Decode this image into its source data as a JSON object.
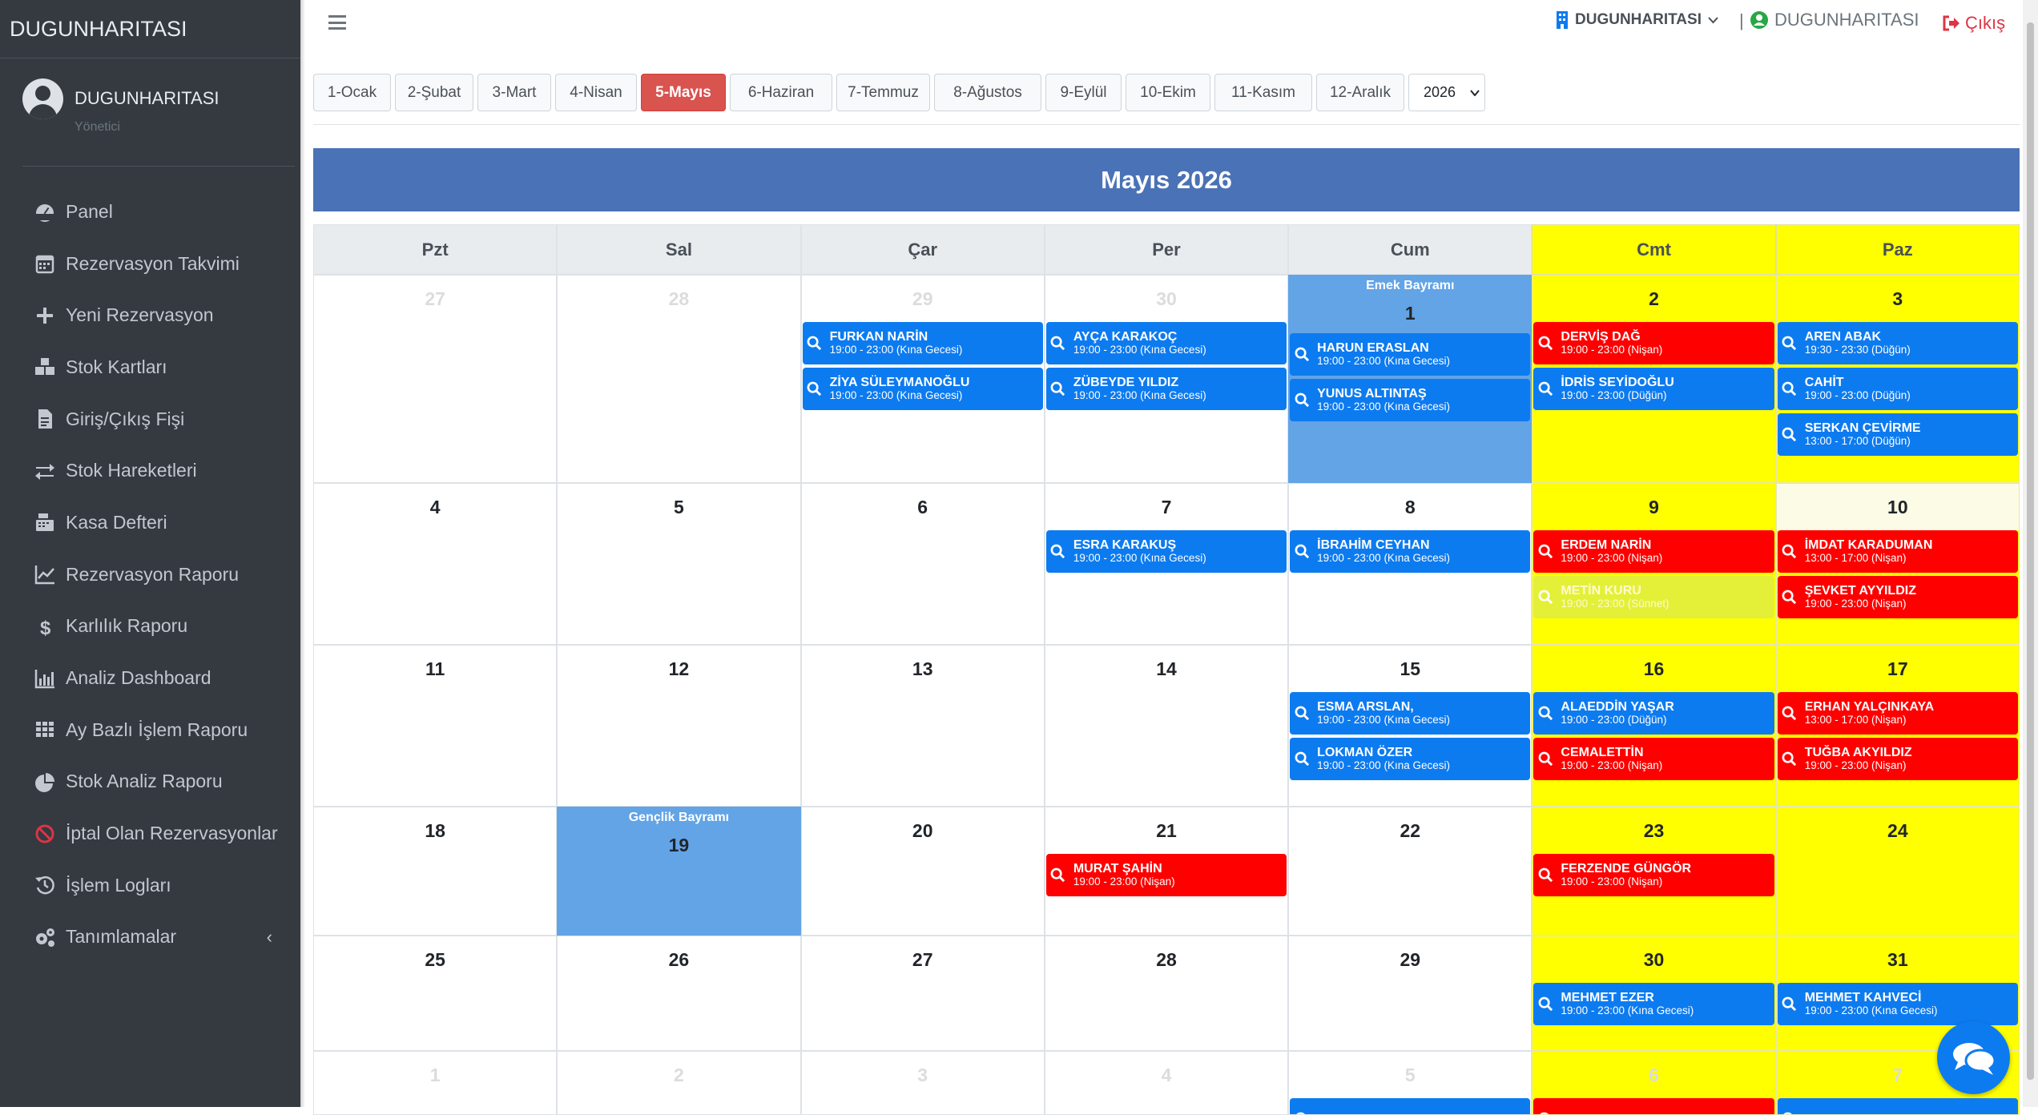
{
  "app": {
    "brand": "DUGUNHARITASI",
    "user_name": "DUGUNHARITASI",
    "user_role": "Yönetici"
  },
  "sidebar": {
    "items": [
      {
        "label": "Panel",
        "icon": "dashboard-icon"
      },
      {
        "label": "Rezervasyon Takvimi",
        "icon": "calendar-icon"
      },
      {
        "label": "Yeni Rezervasyon",
        "icon": "plus-icon"
      },
      {
        "label": "Stok Kartları",
        "icon": "boxes-icon"
      },
      {
        "label": "Giriş/Çıkış Fişi",
        "icon": "file-invoice-icon"
      },
      {
        "label": "Stok Hareketleri",
        "icon": "exchange-icon"
      },
      {
        "label": "Kasa Defteri",
        "icon": "cash-register-icon"
      },
      {
        "label": "Rezervasyon Raporu",
        "icon": "line-chart-icon"
      },
      {
        "label": "Karlılık Raporu",
        "icon": "dollar-icon"
      },
      {
        "label": "Analiz Dashboard",
        "icon": "bar-chart-icon"
      },
      {
        "label": "Ay Bazlı İşlem Raporu",
        "icon": "grid-icon"
      },
      {
        "label": "Stok Analiz Raporu",
        "icon": "pie-chart-icon"
      },
      {
        "label": "İptal Olan Rezervasyonlar",
        "icon": "ban-icon"
      },
      {
        "label": "İşlem Logları",
        "icon": "history-icon"
      },
      {
        "label": "Tanımlamalar",
        "icon": "gears-icon"
      }
    ]
  },
  "topbar": {
    "company": "DUGUNHARITASI",
    "user": "DUGUNHARITASI",
    "logout": "Çıkış",
    "separator": "|"
  },
  "months": [
    "1-Ocak",
    "2-Şubat",
    "3-Mart",
    "4-Nisan",
    "5-Mayıs",
    "6-Haziran",
    "7-Temmuz",
    "8-Ağustos",
    "9-Eylül",
    "10-Ekim",
    "11-Kasım",
    "12-Aralık"
  ],
  "active_month_index": 4,
  "year": "2026",
  "calendar": {
    "title": "Mayıs 2026",
    "weekdays": [
      "Pzt",
      "Sal",
      "Çar",
      "Per",
      "Cum",
      "Cmt",
      "Paz"
    ],
    "weeks": [
      [
        {
          "day": "27",
          "other": true
        },
        {
          "day": "28",
          "other": true
        },
        {
          "day": "29",
          "other": true,
          "events": [
            {
              "name": "FURKAN NARİN",
              "time": "19:00 - 23:00 (Kına Gecesi)",
              "color": "blue"
            },
            {
              "name": "ZİYA SÜLEYMANOĞLU",
              "time": "19:00 - 23:00 (Kına Gecesi)",
              "color": "blue"
            }
          ]
        },
        {
          "day": "30",
          "other": true,
          "events": [
            {
              "name": "AYÇA KARAKOÇ",
              "time": "19:00 - 23:00 (Kına Gecesi)",
              "color": "blue"
            },
            {
              "name": "ZÜBEYDE YILDIZ",
              "time": "19:00 - 23:00 (Kına Gecesi)",
              "color": "blue"
            }
          ]
        },
        {
          "day": "1",
          "holiday": "Emek Bayramı",
          "events": [
            {
              "name": "HARUN ERASLAN",
              "time": "19:00 - 23:00 (Kına Gecesi)",
              "color": "blue"
            },
            {
              "name": "YUNUS ALTINTAŞ",
              "time": "19:00 - 23:00 (Kına Gecesi)",
              "color": "blue"
            }
          ]
        },
        {
          "day": "2",
          "weekend": true,
          "events": [
            {
              "name": "DERVİŞ DAĞ",
              "time": "19:00 - 23:00 (Nişan)",
              "color": "red"
            },
            {
              "name": "İDRİS SEYİDOĞLU",
              "time": "19:00 - 23:00 (Düğün)",
              "color": "blue"
            }
          ]
        },
        {
          "day": "3",
          "weekend": true,
          "events": [
            {
              "name": "AREN ABAK",
              "time": "19:30 - 23:30 (Düğün)",
              "color": "blue"
            },
            {
              "name": "CAHİT",
              "time": "19:00 - 23:00 (Düğün)",
              "color": "blue"
            },
            {
              "name": "SERKAN ÇEVİRME",
              "time": "13:00 - 17:00 (Düğün)",
              "color": "blue"
            }
          ]
        }
      ],
      [
        {
          "day": "4"
        },
        {
          "day": "5"
        },
        {
          "day": "6"
        },
        {
          "day": "7",
          "events": [
            {
              "name": "ESRA KARAKUŞ",
              "time": "19:00 - 23:00 (Kına Gecesi)",
              "color": "blue"
            }
          ]
        },
        {
          "day": "8",
          "events": [
            {
              "name": "İBRAHİM CEYHAN",
              "time": "19:00 - 23:00 (Kına Gecesi)",
              "color": "blue"
            }
          ]
        },
        {
          "day": "9",
          "weekend": true,
          "events": [
            {
              "name": "ERDEM NARİN",
              "time": "19:00 - 23:00 (Nişan)",
              "color": "red"
            },
            {
              "name": "METİN KURU",
              "time": "19:00 - 23:00 (Sünnet)",
              "color": "yellow"
            }
          ]
        },
        {
          "day": "10",
          "weekend": true,
          "today": true,
          "events": [
            {
              "name": "İMDAT KARADUMAN",
              "time": "13:00 - 17:00 (Nişan)",
              "color": "red"
            },
            {
              "name": "ŞEVKET AYYILDIZ",
              "time": "19:00 - 23:00 (Nişan)",
              "color": "red"
            }
          ]
        }
      ],
      [
        {
          "day": "11"
        },
        {
          "day": "12"
        },
        {
          "day": "13"
        },
        {
          "day": "14"
        },
        {
          "day": "15",
          "events": [
            {
              "name": "ESMA ARSLAN,",
              "time": "19:00 - 23:00 (Kına Gecesi)",
              "color": "blue"
            },
            {
              "name": "LOKMAN ÖZER",
              "time": "19:00 - 23:00 (Kına Gecesi)",
              "color": "blue"
            }
          ]
        },
        {
          "day": "16",
          "weekend": true,
          "events": [
            {
              "name": "ALAEDDİN YAŞAR",
              "time": "19:00 - 23:00 (Düğün)",
              "color": "blue"
            },
            {
              "name": "CEMALETTİN",
              "time": "19:00 - 23:00 (Nişan)",
              "color": "red"
            }
          ]
        },
        {
          "day": "17",
          "weekend": true,
          "events": [
            {
              "name": "ERHAN YALÇINKAYA",
              "time": "13:00 - 17:00 (Nişan)",
              "color": "red"
            },
            {
              "name": "TUĞBA AKYILDIZ",
              "time": "19:00 - 23:00 (Nişan)",
              "color": "red"
            }
          ]
        }
      ],
      [
        {
          "day": "18"
        },
        {
          "day": "19",
          "holiday": "Gençlik Bayramı"
        },
        {
          "day": "20"
        },
        {
          "day": "21",
          "events": [
            {
              "name": "MURAT ŞAHİN",
              "time": "19:00 - 23:00 (Nişan)",
              "color": "red"
            }
          ]
        },
        {
          "day": "22"
        },
        {
          "day": "23",
          "weekend": true,
          "events": [
            {
              "name": "FERZENDE GÜNGÖR",
              "time": "19:00 - 23:00 (Nişan)",
              "color": "red"
            }
          ]
        },
        {
          "day": "24",
          "weekend": true
        }
      ],
      [
        {
          "day": "25"
        },
        {
          "day": "26"
        },
        {
          "day": "27"
        },
        {
          "day": "28"
        },
        {
          "day": "29"
        },
        {
          "day": "30",
          "weekend": true,
          "events": [
            {
              "name": "MEHMET EZER",
              "time": "19:00 - 23:00 (Kına Gecesi)",
              "color": "blue"
            }
          ]
        },
        {
          "day": "31",
          "weekend": true,
          "events": [
            {
              "name": "MEHMET KAHVECİ",
              "time": "19:00 - 23:00 (Kına Gecesi)",
              "color": "blue"
            }
          ]
        }
      ],
      [
        {
          "day": "1",
          "other": true
        },
        {
          "day": "2",
          "other": true
        },
        {
          "day": "3",
          "other": true
        },
        {
          "day": "4",
          "other": true
        },
        {
          "day": "5",
          "other": true,
          "events": [
            {
              "name": "",
              "time": "",
              "color": "blue"
            }
          ]
        },
        {
          "day": "6",
          "other": true,
          "weekend": true,
          "events": [
            {
              "name": "",
              "time": "",
              "color": "red"
            }
          ]
        },
        {
          "day": "7",
          "other": true,
          "weekend": true,
          "events": [
            {
              "name": "",
              "time": "",
              "color": "blue"
            }
          ]
        }
      ]
    ]
  },
  "colors": {
    "sidebar": "#343a40",
    "accent_blue": "#0d7bf0",
    "event_red": "#ff0000",
    "weekend": "#ffff00",
    "holiday": "#62a4e6",
    "title_bar": "#4a72b6"
  }
}
